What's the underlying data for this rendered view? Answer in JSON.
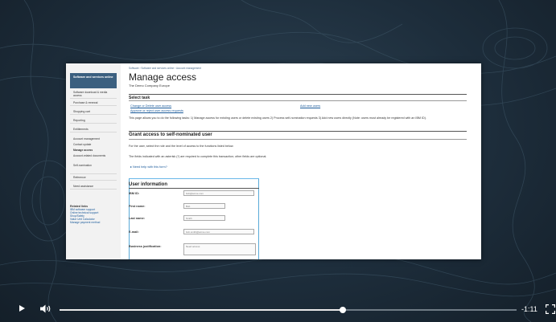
{
  "slide": {
    "sidebar": {
      "active": "Software and services online",
      "items": [
        "Software download & media access",
        "Purchase & renewal",
        "Shopping cart",
        "Reporting",
        "Entitlements",
        "Account management"
      ],
      "subitems": [
        "Contact update",
        "Manage access",
        "Account-related documents",
        "Self-nomination"
      ],
      "extra_items": [
        "Reference",
        "Need assistance"
      ],
      "related_title": "Related links",
      "related": [
        "IBM software support",
        "Online technical support",
        "Shop/Safely",
        "Value Unit Calculator",
        "Manage payment method"
      ]
    },
    "breadcrumb": "Software  ›  Software and services online  ›  Account management",
    "title": "Manage access",
    "subtitle": "The Demo Company Europe",
    "select_task": {
      "heading": "Select task",
      "link1": "Change or Delete user access",
      "link2": "Approve or reject user access requests",
      "link3": "Add new users"
    },
    "description": "This page allows you to do the following tasks: 1) Manage access for existing users or delete existing users 2) Process self-nomination requests 3) Add new users directly (Note: users must already be registered with an IBM ID).",
    "grant": {
      "heading": "Grant access to self-nominated user",
      "intro": "For the user, select the role and the level of access to the functions listed below.",
      "required_note": "The fields indicated with an asterisk (*) are required to complete this transaction; other fields are optional.",
      "help_link": "Need help with this form?"
    },
    "user_info": {
      "heading": "User information",
      "fields": [
        {
          "label": "IBM ID:",
          "value": "bob@acme.com"
        },
        {
          "label": "First name:",
          "value": "Bob"
        },
        {
          "label": "Last name:",
          "value": "Smith"
        },
        {
          "label": "E-mail:",
          "value": "bob.smith@acme.com"
        },
        {
          "label": "Business justification:",
          "value": "Need access"
        }
      ]
    }
  },
  "player": {
    "time_remaining": "-1:11",
    "progress": 0.62
  }
}
